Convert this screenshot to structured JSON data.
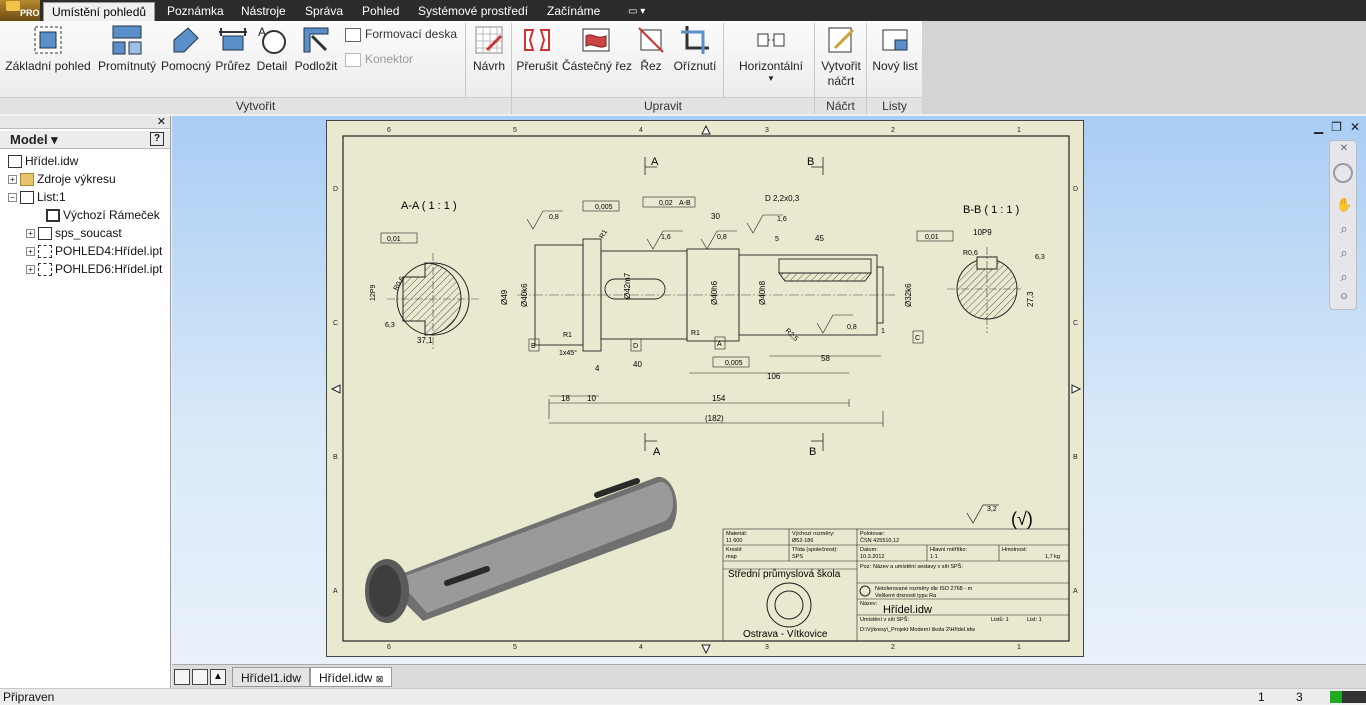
{
  "ribbon_tabs": [
    "Umístění pohledů",
    "Poznámka",
    "Nástroje",
    "Správa",
    "Pohled",
    "Systémové prostředí",
    "Začínáme"
  ],
  "app_badge": "PRO",
  "ribbon": {
    "create_buttons": [
      "Základní pohled",
      "Promítnutý",
      "Pomocný",
      "Průřez",
      "Detail",
      "Podložit"
    ],
    "small_buttons": [
      "Formovací deska",
      "Konektor"
    ],
    "design_button": "Návrh",
    "modify_buttons": [
      "Přerušit",
      "Částečný řez",
      "Řez",
      "Oříznutí"
    ],
    "horizontal_button": "Horizontální",
    "sketch_button_line1": "Vytvořit",
    "sketch_button_line2": "náčrt",
    "new_sheet_button": "Nový list",
    "panels": {
      "create": "Vytvořit",
      "modify": "Upravit",
      "sketch": "Náčrt",
      "sheets": "Listy"
    }
  },
  "browser": {
    "title": "Model",
    "help": "?",
    "tree": [
      "Hřídel.idw",
      "Zdroje výkresu",
      "List:1",
      "Výchozí Rámeček",
      "sps_soucast",
      "POHLED4:Hřídel.ipt",
      "POHLED6:Hřídel.ipt"
    ]
  },
  "drawing": {
    "view_a_label": "A-A ( 1 : 1 )",
    "view_b_label": "B-B ( 1 : 1 )",
    "section_a": "A",
    "section_b": "B",
    "tolerance_001": "0,01",
    "tolerance_0005": "0,005",
    "tolerance_002": "0,02",
    "datum_ab": "A-B",
    "d_label": "D 2,2x0,3",
    "dim_30": "30",
    "dim_45": "45",
    "dim_58": "58",
    "dim_106": "106",
    "dim_154": "154",
    "dim_182": "(182)",
    "dim_18": "18",
    "dim_10": "10",
    "dim_4": "4",
    "dim_40": "40",
    "dim_37": "37,1",
    "dim_27": "27,3",
    "dim_1x45": "1x45°",
    "dia_49": "Ø49",
    "dia_40k6": "Ø40k6",
    "dia_42m7": "Ø42m7",
    "dia_40h6": "Ø40h6",
    "dia_40h8": "Ø40h8",
    "dia_32k6": "Ø32k6",
    "key_12p9": "12P9",
    "key_10p9": "10P9",
    "r1": "R1",
    "r06": "R0,6",
    "r25": "R2,5",
    "rough_08": "0,8",
    "rough_16": "1,6",
    "rough_63": "6,3",
    "rough_32": "3,2",
    "chamfer_5": "5",
    "chamfer_1": "1",
    "datum_b": "B",
    "datum_d": "D",
    "datum_a": "A",
    "datum_c": "C",
    "border_nums": [
      "6",
      "5",
      "4",
      "3",
      "2",
      "1"
    ],
    "border_letters": [
      "D",
      "C",
      "B",
      "A"
    ]
  },
  "title_block": {
    "material_lbl": "Materiál:",
    "material": "11 600",
    "semi_lbl": "Výchozí rozměry:",
    "semi": "Ø52-186",
    "position_lbl": "Polotovar:",
    "position": "ČSN 425510,12",
    "drawn_lbl": "Kreslil:",
    "drawn": "map",
    "class_lbl": "Třída (společnost):",
    "class": "SPS",
    "date_lbl": "Datum:",
    "date": "10.3.2012",
    "scale_lbl": "Hlavní měřítko:",
    "scale": "1:1",
    "mass_lbl": "Hmotnost:",
    "mass": "1,7 kg",
    "school": "Střední průmyslová škola",
    "city": "Ostrava - Vítkovice",
    "note_lbl": "Poz:",
    "note": "Název a umístění sestavy v síti SPŠ:",
    "tol_note1": "Netolerované rozměry dle ISO 2768 - m",
    "tol_note2": "Veškeré drsnosti typu Ra",
    "name_lbl": "Název:",
    "name": "Hřídel.idw",
    "loc_lbl": "Umístění v síti SPŠ:",
    "loc": "D:\\Výkresy\\_Projekt Moderní škola 2\\Hřídel.idw",
    "sheets_lbl": "Listů: 1",
    "sheet_lbl": "List: 1"
  },
  "bottom_tabs": [
    "Hřídel1.idw",
    "Hřídel.idw"
  ],
  "status": {
    "text": "Připraven",
    "n1": "1",
    "n2": "3"
  }
}
